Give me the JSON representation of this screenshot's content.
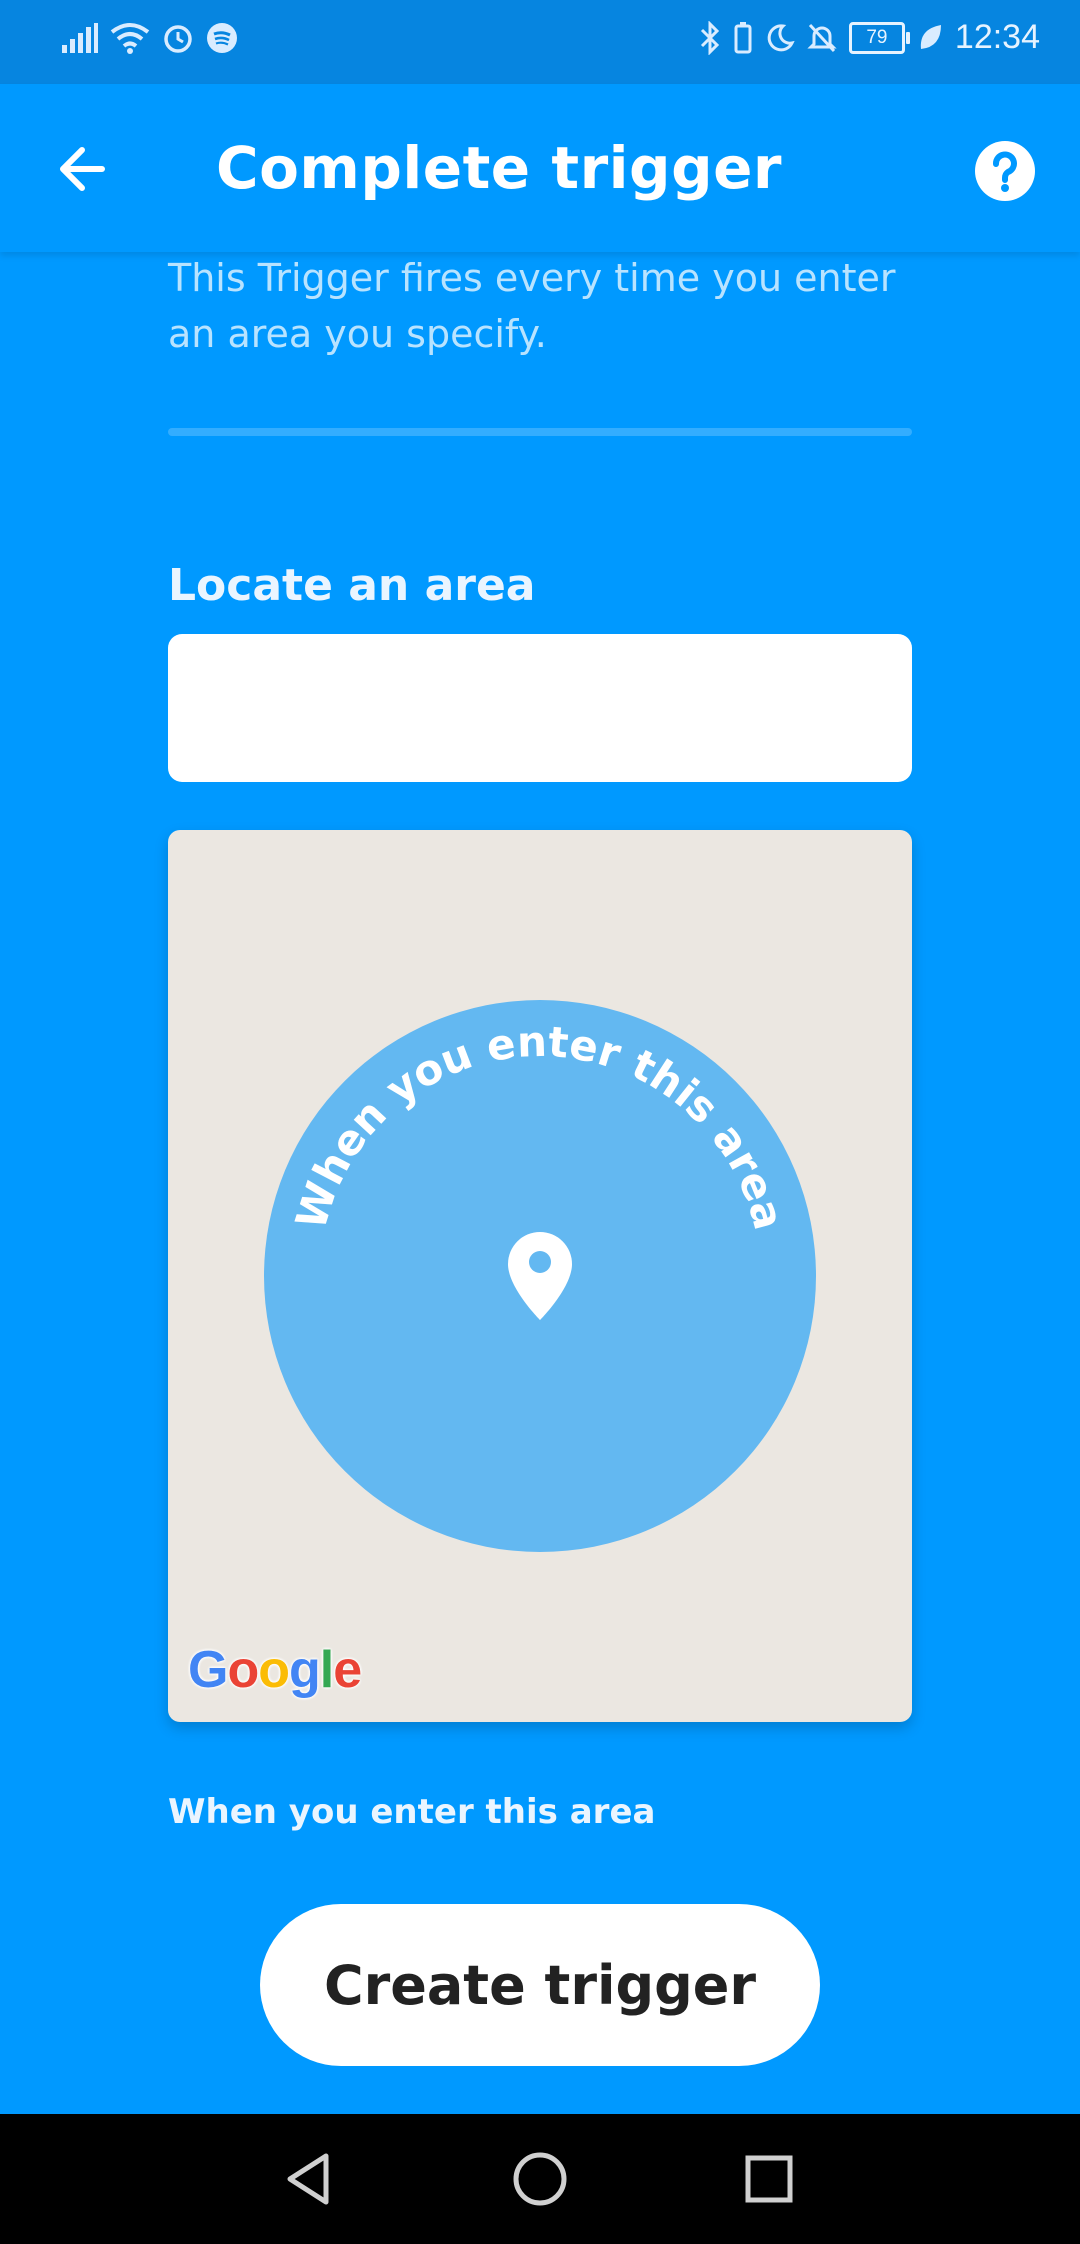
{
  "status_bar": {
    "time": "12:34",
    "battery": "79",
    "icons_left": [
      "signal-icon",
      "wifi-icon",
      "alarm-icon",
      "spotify-icon"
    ],
    "icons_right": [
      "bluetooth-icon",
      "moon-icon",
      "bell-off-icon",
      "battery-icon",
      "leaf-icon"
    ]
  },
  "header": {
    "title": "Complete trigger",
    "back_icon": "arrow-left-icon",
    "help_icon": "help-circle-icon"
  },
  "main": {
    "description": "This Trigger fires every time you enter an area you specify.",
    "locate_label": "Locate an area",
    "locate_value": "",
    "map": {
      "arc_text": "When you enter this area",
      "logo_letters": [
        "G",
        "o",
        "o",
        "g",
        "l",
        "e"
      ]
    },
    "area_caption": "When you enter this area",
    "create_button": "Create trigger"
  },
  "nav": {
    "back": "nav-back-icon",
    "home": "nav-home-icon",
    "recents": "nav-recents-icon"
  },
  "colors": {
    "primary": "#0099ff",
    "status_bar": "#0685e0",
    "area_circle": "#63b8f1",
    "map_bg": "#ebe7e1"
  }
}
